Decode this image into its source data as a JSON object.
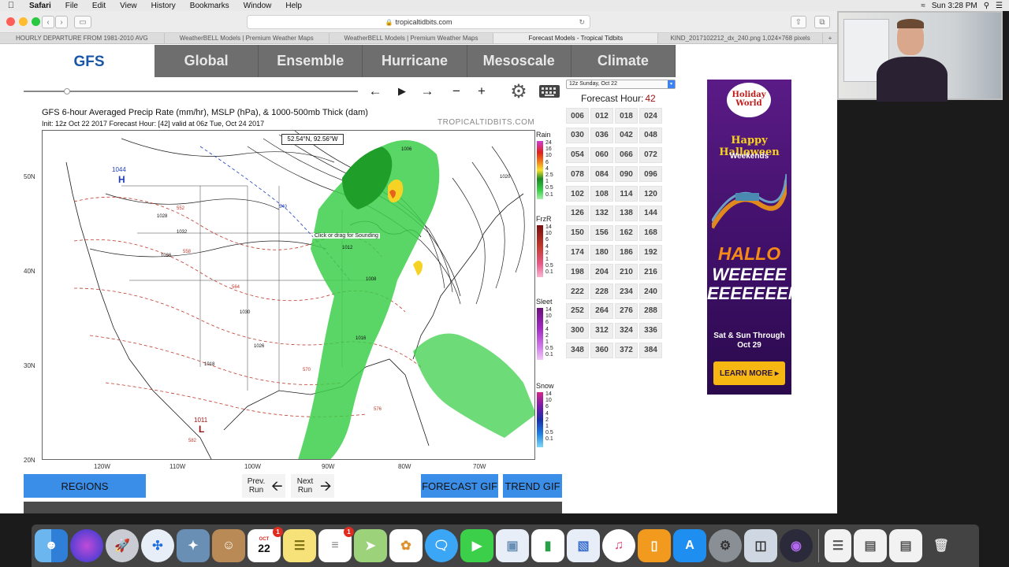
{
  "menubar": {
    "apple_icon": "apple-logo",
    "items": [
      "Safari",
      "File",
      "Edit",
      "View",
      "History",
      "Bookmarks",
      "Window",
      "Help"
    ],
    "clock": "Sun 3:28 PM"
  },
  "browser": {
    "url": "tropicaltidbits.com",
    "tabs": [
      "HOURLY DEPARTURE FROM 1981-2010 AVG",
      "WeatherBELL Models | Premium Weather Maps",
      "WeatherBELL Models | Premium Weather Maps",
      "Forecast Models - Tropical Tidbits",
      "KIND_2017102212_dx_240.png 1,024×768 pixels"
    ],
    "active_tab_index": 3
  },
  "site": {
    "model_label": "GFS",
    "nav": [
      "Global",
      "Ensemble",
      "Hurricane",
      "Mesoscale",
      "Climate"
    ],
    "run_select": "12z Sunday, Oct 22",
    "forecast_hour_label": "Forecast Hour:",
    "forecast_hour_value": "42",
    "controls": {
      "back": "←",
      "play": "▶",
      "forward": "→",
      "minus": "−",
      "plus": "+"
    },
    "loop_slider_position": 0.12,
    "hours": [
      "006",
      "012",
      "018",
      "024",
      "030",
      "036",
      "042",
      "048",
      "054",
      "060",
      "066",
      "072",
      "078",
      "084",
      "090",
      "096",
      "102",
      "108",
      "114",
      "120",
      "126",
      "132",
      "138",
      "144",
      "150",
      "156",
      "162",
      "168",
      "174",
      "180",
      "186",
      "192",
      "198",
      "204",
      "210",
      "216",
      "222",
      "228",
      "234",
      "240",
      "246",
      "252",
      "258",
      "264",
      "270",
      "276",
      "282",
      "288",
      "294",
      "300",
      "306",
      "312",
      "318",
      "324",
      "330",
      "336",
      "342",
      "348",
      "354",
      "360",
      "366",
      "372",
      "378",
      "384"
    ]
  },
  "map": {
    "title": "GFS 6-hour Averaged Precip Rate (mm/hr), MSLP (hPa), & 1000-500mb Thick (dam)",
    "init": "Init: 12z Oct 22 2017   Forecast Hour: [42]   valid at 06z Tue, Oct 24 2017",
    "brand": "TROPICALTIDBITS.COM",
    "coord_readout": "52.54°N, 92.56°W",
    "hint": "Click or drag for Sounding",
    "lat_labels": [
      "50N",
      "40N",
      "30N",
      "20N"
    ],
    "lon_labels": [
      "120W",
      "110W",
      "100W",
      "90W",
      "80W",
      "70W"
    ],
    "pressure_labels": [
      "1044",
      "H",
      "1011",
      "L",
      "1028",
      "1032",
      "1036",
      "1030",
      "1026",
      "1018",
      "1016",
      "1008",
      "1012",
      "1020",
      "1006"
    ],
    "thickness_labels": [
      "552",
      "558",
      "564",
      "570",
      "576",
      "582",
      "540"
    ],
    "scales": [
      {
        "name": "Rain",
        "ticks": [
          "24",
          "16",
          "10",
          "6",
          "4",
          "2.5",
          "1",
          "0.5",
          "0.1"
        ]
      },
      {
        "name": "FrzR",
        "ticks": [
          "14",
          "10",
          "6",
          "4",
          "2",
          "1",
          "0.5",
          "0.1"
        ]
      },
      {
        "name": "Sleet",
        "ticks": [
          "14",
          "10",
          "6",
          "4",
          "2",
          "1",
          "0.5",
          "0.1"
        ]
      },
      {
        "name": "Snow",
        "ticks": [
          "14",
          "10",
          "6",
          "4",
          "2",
          "1",
          "0.5",
          "0.1"
        ]
      }
    ]
  },
  "buttons": {
    "regions": "REGIONS",
    "prev_run": "Prev. Run",
    "next_run": "Next Run",
    "forecast_gif": "FORECAST GIF",
    "trend_gif": "TREND GIF"
  },
  "ad": {
    "logo_text": "Holiday World",
    "headline": "Happy Halloween",
    "sub": "Weekends",
    "big1": "HALLO",
    "big2": "WEEEEE EEEEEEEN",
    "dates": "Sat & Sun Through Oct 29",
    "cta": "LEARN MORE ▸"
  },
  "dock": {
    "calendar_month": "OCT",
    "calendar_day": "22",
    "badge_count": "1",
    "apps": [
      "finder-icon",
      "siri-icon",
      "launchpad-icon",
      "safari-icon",
      "photo-app-icon",
      "contacts-icon",
      "calendar-icon",
      "notes-icon",
      "reminders-icon",
      "maps-icon",
      "photos-icon",
      "messages-icon",
      "facetime-icon",
      "preview-icon",
      "numbers-icon",
      "keynote-icon",
      "itunes-icon",
      "ibooks-icon",
      "app-store-icon",
      "system-preferences-icon",
      "screen-capture-icon",
      "browser-icon"
    ]
  }
}
